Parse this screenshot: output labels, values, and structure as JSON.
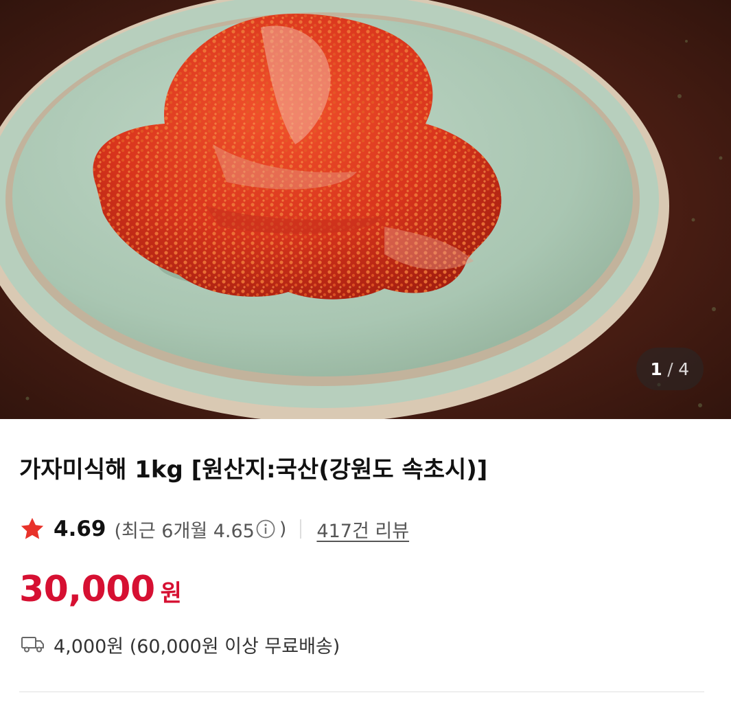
{
  "gallery": {
    "current": "1",
    "separator": "/",
    "total": "4",
    "image_icon": "product-photo-salted-fish-kimchi"
  },
  "product": {
    "title": "가자미식해 1kg [원산지:국산(강원도 속초시)]"
  },
  "rating": {
    "star_icon": "star-icon",
    "value": "4.69",
    "recent_open": "(최근 6개월 4.65",
    "info_icon": "info-icon",
    "recent_close": ")",
    "reviews": "417건 리뷰"
  },
  "price": {
    "amount": "30,000",
    "currency": "원"
  },
  "shipping": {
    "icon": "truck-icon",
    "text": "4,000원 (60,000원 이상 무료배송)"
  },
  "colors": {
    "price": "#d61032",
    "star": "#e8322a",
    "text": "#111111",
    "subtext": "#555555"
  }
}
